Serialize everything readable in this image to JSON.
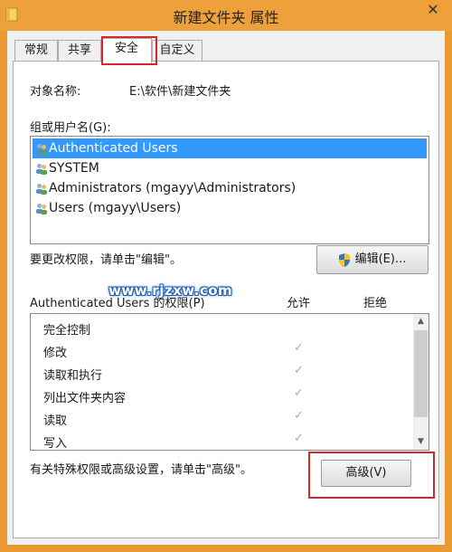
{
  "window": {
    "title": "新建文件夹 属性",
    "close_symbol": "✕"
  },
  "tabs": [
    {
      "label": "常规"
    },
    {
      "label": "共享"
    },
    {
      "label": "安全"
    },
    {
      "label": "自定义"
    }
  ],
  "active_tab": "安全",
  "object_name": {
    "label": "对象名称:",
    "value": "E:\\软件\\新建文件夹"
  },
  "group_or_user": {
    "label": "组或用户名(G):",
    "items": [
      {
        "name": "Authenticated Users",
        "selected": true
      },
      {
        "name": "SYSTEM",
        "selected": false
      },
      {
        "name": "Administrators (mgayy\\Administrators)",
        "selected": false
      },
      {
        "name": "Users (mgayy\\Users)",
        "selected": false
      }
    ]
  },
  "change_permissions": {
    "text": "要更改权限，请单击\"编辑\"。",
    "edit_button": "编辑(E)..."
  },
  "watermark": "www.rjzxw.com",
  "permissions": {
    "header": "Authenticated Users 的权限(P)",
    "allow_label": "允许",
    "deny_label": "拒绝",
    "rows": [
      {
        "name": "完全控制",
        "allow": ""
      },
      {
        "name": "修改",
        "allow": "✓"
      },
      {
        "name": "读取和执行",
        "allow": "✓"
      },
      {
        "name": "列出文件夹内容",
        "allow": "✓"
      },
      {
        "name": "读取",
        "allow": "✓"
      },
      {
        "name": "写入",
        "allow": "✓"
      }
    ]
  },
  "advanced": {
    "text": "有关特殊权限或高级设置，请单击\"高级\"。",
    "button": "高级(V)"
  },
  "colors": {
    "title_bar": "#eea13a",
    "selection": "#3399ff",
    "highlight_box": "#d8262b"
  }
}
